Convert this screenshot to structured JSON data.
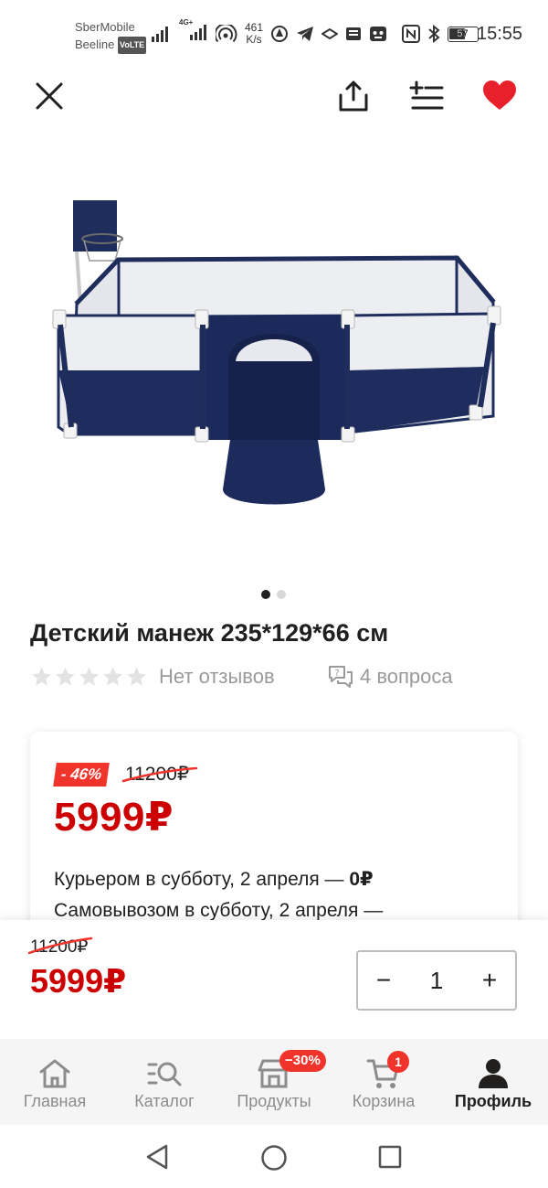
{
  "status_bar": {
    "carrier_1": "SberMobile",
    "carrier_2": "Beeline",
    "volte": "VoLTE",
    "network_badge": "4G+",
    "speed_value": "461",
    "speed_unit": "K/s",
    "battery": "57",
    "time": "15:55"
  },
  "topbar": {
    "icons": [
      "close-icon",
      "share-icon",
      "add-to-list-icon",
      "heart-icon"
    ],
    "favorite_color": "#e8202c"
  },
  "gallery": {
    "image_count": 2,
    "active_index": 0
  },
  "product": {
    "title": "Детский манеж 235*129*66 см",
    "stars_filled": 0,
    "stars_total": 5,
    "reviews_text": "Нет отзывов",
    "questions_text": "4 вопроса"
  },
  "price_card": {
    "discount": "- 46%",
    "old_price": "11200₽",
    "price": "5999₽",
    "delivery_courier": "Курьером в субботу, 2 апреля — ",
    "delivery_courier_price": "0₽",
    "delivery_pickup": "Самовывозом в субботу, 2 апреля —"
  },
  "price_bar": {
    "old_price": "11200₽",
    "price": "5999₽",
    "minus": "−",
    "quantity": "1",
    "plus": "+"
  },
  "bottom_nav": {
    "items": [
      {
        "label": "Главная",
        "icon": "home-icon"
      },
      {
        "label": "Каталог",
        "icon": "catalog-search-icon"
      },
      {
        "label": "Продукты",
        "icon": "grocery-store-icon",
        "badge": "−30%"
      },
      {
        "label": "Корзина",
        "icon": "cart-icon",
        "badge": "1"
      },
      {
        "label": "Профиль",
        "icon": "profile-icon",
        "active": true
      }
    ]
  },
  "colors": {
    "price_red": "#cc0000",
    "badge_red": "#f0342b",
    "text": "#21201f",
    "muted": "#9a9a9a"
  }
}
